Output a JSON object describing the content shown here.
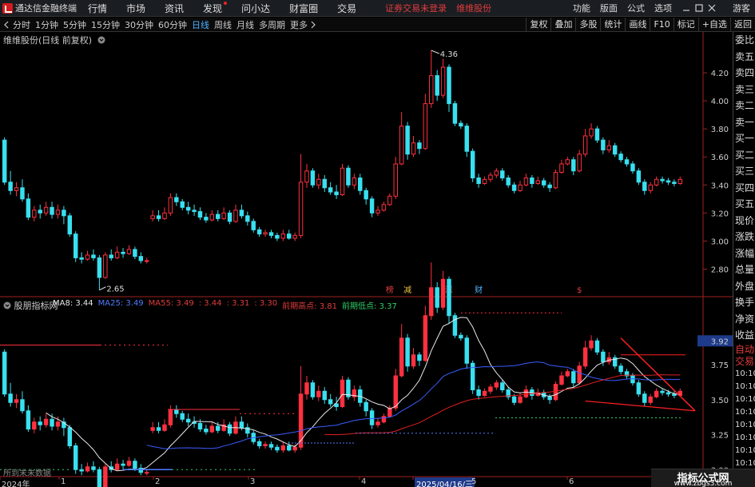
{
  "app": {
    "title": "通达信金融终端",
    "login_status": "证券交易未登录",
    "stock_name": "维维股份",
    "guest": "游客"
  },
  "menu": [
    "行情",
    "市场",
    "资讯",
    "发现",
    "问小达",
    "财富圈",
    "交易"
  ],
  "menu_right": [
    "功能",
    "版面",
    "公式",
    "选项"
  ],
  "periods": [
    {
      "label": "分时",
      "active": false
    },
    {
      "label": "1分钟",
      "active": false
    },
    {
      "label": "5分钟",
      "active": false
    },
    {
      "label": "15分钟",
      "active": false
    },
    {
      "label": "30分钟",
      "active": false
    },
    {
      "label": "60分钟",
      "active": false
    },
    {
      "label": "日线",
      "active": true
    },
    {
      "label": "周线",
      "active": false
    },
    {
      "label": "月线",
      "active": false
    },
    {
      "label": "多周期",
      "active": false
    },
    {
      "label": "更多",
      "active": false
    }
  ],
  "tools": [
    "复权",
    "叠加",
    "多股",
    "统计",
    "画线",
    "F10",
    "标记",
    "+自选",
    "返回"
  ],
  "main_chart": {
    "title": "维维股份(日线 前复权)",
    "y_ticks": [
      "4.20",
      "4.00",
      "3.80",
      "3.60",
      "3.40",
      "3.20",
      "3.00",
      "2.80"
    ],
    "high_label": "4.36",
    "low_label": "2.65",
    "markers": [
      {
        "text": "榜",
        "color": "#e23c3c"
      },
      {
        "text": "减",
        "color": "#e8c040"
      },
      {
        "text": "涨",
        "color": "#e23c3c"
      },
      {
        "text": "财",
        "color": "#4fb3ff"
      },
      {
        "text": "$",
        "color": "#e23c3c"
      }
    ],
    "candles": [
      [
        3.72,
        3.42,
        3.74,
        3.4
      ],
      [
        3.42,
        3.36,
        3.5,
        3.33
      ],
      [
        3.36,
        3.38,
        3.42,
        3.32
      ],
      [
        3.38,
        3.3,
        3.44,
        3.28
      ],
      [
        3.3,
        3.17,
        3.34,
        3.15
      ],
      [
        3.17,
        3.22,
        3.25,
        3.14
      ],
      [
        3.22,
        3.2,
        3.26,
        3.16
      ],
      [
        3.2,
        3.24,
        3.28,
        3.18
      ],
      [
        3.24,
        3.19,
        3.28,
        3.16
      ],
      [
        3.19,
        3.22,
        3.26,
        3.16
      ],
      [
        3.22,
        3.18,
        3.25,
        3.12
      ],
      [
        3.18,
        3.05,
        3.2,
        3.03
      ],
      [
        3.05,
        2.88,
        3.07,
        2.85
      ],
      [
        2.88,
        2.87,
        2.92,
        2.84
      ],
      [
        2.87,
        2.9,
        2.93,
        2.86
      ],
      [
        2.9,
        2.88,
        2.94,
        2.86
      ],
      [
        2.88,
        2.74,
        2.9,
        2.65
      ],
      [
        2.74,
        2.9,
        2.92,
        2.73
      ],
      [
        2.9,
        2.88,
        2.94,
        2.86
      ],
      [
        2.88,
        2.92,
        2.96,
        2.87
      ],
      [
        2.92,
        2.91,
        2.95,
        2.88
      ],
      [
        2.91,
        2.94,
        2.97,
        2.9
      ],
      [
        2.94,
        2.89,
        2.96,
        2.87
      ],
      [
        2.89,
        2.86,
        2.92,
        2.84
      ],
      [
        2.86,
        2.86,
        2.88,
        2.84
      ],
      [
        3.16,
        3.18,
        3.22,
        3.14
      ],
      [
        3.18,
        3.16,
        3.22,
        3.14
      ],
      [
        3.16,
        3.2,
        3.24,
        3.15
      ],
      [
        3.2,
        3.31,
        3.34,
        3.18
      ],
      [
        3.31,
        3.28,
        3.34,
        3.25
      ],
      [
        3.28,
        3.24,
        3.3,
        3.22
      ],
      [
        3.24,
        3.22,
        3.28,
        3.19
      ],
      [
        3.22,
        3.21,
        3.26,
        3.18
      ],
      [
        3.21,
        3.17,
        3.24,
        3.15
      ],
      [
        3.17,
        3.15,
        3.2,
        3.13
      ],
      [
        3.15,
        3.19,
        3.22,
        3.14
      ],
      [
        3.19,
        3.16,
        3.22,
        3.14
      ],
      [
        3.16,
        3.2,
        3.24,
        3.15
      ],
      [
        3.2,
        3.14,
        3.22,
        3.12
      ],
      [
        3.14,
        3.22,
        3.26,
        3.13
      ],
      [
        3.22,
        3.18,
        3.26,
        3.16
      ],
      [
        3.18,
        3.14,
        3.21,
        3.11
      ],
      [
        3.14,
        3.08,
        3.16,
        3.06
      ],
      [
        3.08,
        3.05,
        3.1,
        3.03
      ],
      [
        3.05,
        3.06,
        3.08,
        3.03
      ],
      [
        3.06,
        3.04,
        3.08,
        3.02
      ],
      [
        3.04,
        3.02,
        3.06,
        3.0
      ],
      [
        3.02,
        3.05,
        3.08,
        3.0
      ],
      [
        3.05,
        3.02,
        3.08,
        3.01
      ],
      [
        3.02,
        3.04,
        3.06,
        3.0
      ],
      [
        3.04,
        3.42,
        3.62,
        3.02
      ],
      [
        3.42,
        3.5,
        3.55,
        3.38
      ],
      [
        3.5,
        3.4,
        3.52,
        3.38
      ],
      [
        3.4,
        3.44,
        3.48,
        3.37
      ],
      [
        3.44,
        3.38,
        3.47,
        3.35
      ],
      [
        3.38,
        3.35,
        3.42,
        3.33
      ],
      [
        3.35,
        3.33,
        3.4,
        3.3
      ],
      [
        3.33,
        3.52,
        3.55,
        3.32
      ],
      [
        3.52,
        3.4,
        3.54,
        3.38
      ],
      [
        3.4,
        3.45,
        3.48,
        3.37
      ],
      [
        3.45,
        3.36,
        3.48,
        3.33
      ],
      [
        3.36,
        3.3,
        3.38,
        3.26
      ],
      [
        3.3,
        3.2,
        3.32,
        3.17
      ],
      [
        3.2,
        3.22,
        3.25,
        3.18
      ],
      [
        3.22,
        3.26,
        3.28,
        3.21
      ],
      [
        3.26,
        3.32,
        3.34,
        3.25
      ],
      [
        3.32,
        3.55,
        3.6,
        3.3
      ],
      [
        3.55,
        3.82,
        3.92,
        3.54
      ],
      [
        3.82,
        3.62,
        3.85,
        3.58
      ],
      [
        3.62,
        3.7,
        3.75,
        3.6
      ],
      [
        3.7,
        3.66,
        3.72,
        3.62
      ],
      [
        3.66,
        3.98,
        4.05,
        3.65
      ],
      [
        3.98,
        4.18,
        4.36,
        3.95
      ],
      [
        4.18,
        4.04,
        4.22,
        4.0
      ],
      [
        4.04,
        4.24,
        4.3,
        4.02
      ],
      [
        4.24,
        3.98,
        4.26,
        3.92
      ],
      [
        3.98,
        3.84,
        4.0,
        3.82
      ],
      [
        3.84,
        3.82,
        3.86,
        3.8
      ],
      [
        3.82,
        3.64,
        3.84,
        3.6
      ],
      [
        3.64,
        3.45,
        3.66,
        3.42
      ],
      [
        3.45,
        3.41,
        3.48,
        3.38
      ],
      [
        3.41,
        3.44,
        3.46,
        3.4
      ],
      [
        3.44,
        3.47,
        3.49,
        3.42
      ],
      [
        3.47,
        3.5,
        3.52,
        3.45
      ],
      [
        3.5,
        3.45,
        3.52,
        3.43
      ],
      [
        3.45,
        3.4,
        3.47,
        3.38
      ],
      [
        3.4,
        3.36,
        3.42,
        3.34
      ],
      [
        3.36,
        3.4,
        3.43,
        3.35
      ],
      [
        3.4,
        3.45,
        3.48,
        3.39
      ],
      [
        3.45,
        3.41,
        3.47,
        3.38
      ],
      [
        3.41,
        3.43,
        3.46,
        3.4
      ],
      [
        3.43,
        3.4,
        3.45,
        3.38
      ],
      [
        3.4,
        3.38,
        3.42,
        3.35
      ],
      [
        3.38,
        3.49,
        3.51,
        3.37
      ],
      [
        3.49,
        3.55,
        3.58,
        3.48
      ],
      [
        3.55,
        3.58,
        3.6,
        3.54
      ],
      [
        3.58,
        3.5,
        3.6,
        3.47
      ],
      [
        3.5,
        3.62,
        3.65,
        3.49
      ],
      [
        3.62,
        3.75,
        3.8,
        3.6
      ],
      [
        3.75,
        3.8,
        3.84,
        3.73
      ],
      [
        3.8,
        3.72,
        3.82,
        3.7
      ],
      [
        3.72,
        3.65,
        3.74,
        3.62
      ],
      [
        3.65,
        3.68,
        3.72,
        3.63
      ],
      [
        3.68,
        3.62,
        3.7,
        3.6
      ],
      [
        3.62,
        3.58,
        3.64,
        3.56
      ],
      [
        3.58,
        3.55,
        3.6,
        3.53
      ],
      [
        3.55,
        3.5,
        3.57,
        3.48
      ],
      [
        3.5,
        3.42,
        3.52,
        3.4
      ],
      [
        3.42,
        3.36,
        3.44,
        3.33
      ],
      [
        3.36,
        3.4,
        3.42,
        3.34
      ],
      [
        3.4,
        3.44,
        3.46,
        3.39
      ],
      [
        3.44,
        3.43,
        3.46,
        3.41
      ],
      [
        3.43,
        3.42,
        3.45,
        3.4
      ],
      [
        3.42,
        3.41,
        3.44,
        3.39
      ],
      [
        3.41,
        3.44,
        3.46,
        3.4
      ]
    ]
  },
  "indicator": {
    "title": "股朋指标网",
    "values": [
      {
        "text": "MA8: 3.44",
        "color": "#e8e8e8"
      },
      {
        "text": "MA25: 3.49",
        "color": "#4f7dff"
      },
      {
        "text": "MA55: 3.49",
        "color": "#e23c3c"
      },
      {
        "text": ": 3.44",
        "color": "#e23c3c"
      },
      {
        "text": ": 3.31",
        "color": "#e23c3c"
      },
      {
        "text": ": 3.30",
        "color": "#e23c3c"
      },
      {
        "text": "前期高点: 3.81",
        "color": "#e23c3c"
      },
      {
        "text": "前期低点: 3.37",
        "color": "#2fd06a"
      }
    ],
    "y_ticks": [
      "3.92",
      "3.75",
      "3.50",
      "3.25",
      "3.00"
    ],
    "note": "所到末未数据"
  },
  "x_axis": [
    "2024年",
    "1",
    "2",
    "3",
    "4",
    "2025/04/16/三",
    "5",
    "6"
  ],
  "quote_panel": [
    "委比",
    "卖五",
    "卖四",
    "卖三",
    "卖二",
    "卖一",
    "买一",
    "买二",
    "买三",
    "买四",
    "买五",
    "现价",
    "涨跌",
    "涨幅",
    "总量",
    "外盘",
    "换手",
    "净资",
    "收益"
  ],
  "quote_panel_red": [
    "自动",
    "交易"
  ],
  "quote_times": [
    "10:10",
    "10:10",
    "10:10",
    "10:10",
    "10:10",
    "10:10",
    "10:10",
    "10:10",
    "10:10"
  ],
  "watermark": {
    "title": "指标公式网",
    "url": "www.zbgs3.com"
  },
  "colors": {
    "up": "#ff3040",
    "down": "#38e0f0",
    "ma_white": "#e8e8e8",
    "ma_blue": "#3a5cff",
    "ma_red": "#e02020"
  }
}
